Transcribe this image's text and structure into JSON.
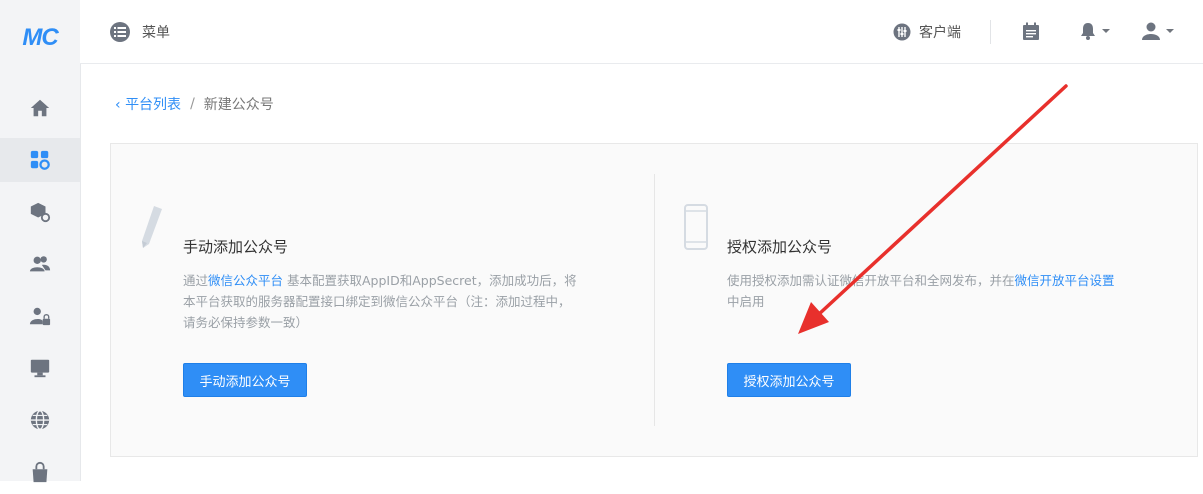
{
  "brand": {
    "logo_text": "MC",
    "accent": "#2f8ef6"
  },
  "sidebar": {
    "items": [
      {
        "icon": "home-icon"
      },
      {
        "icon": "apps-settings-icon",
        "active": true
      },
      {
        "icon": "package-settings-icon"
      },
      {
        "icon": "users-icon"
      },
      {
        "icon": "user-lock-icon"
      },
      {
        "icon": "monitor-icon"
      },
      {
        "icon": "globe-icon"
      },
      {
        "icon": "shopping-bag-icon"
      }
    ]
  },
  "header": {
    "menu_label": "菜单",
    "client_label": "客户端",
    "icons": [
      "calendar-icon",
      "bell-icon",
      "user-icon"
    ]
  },
  "breadcrumb": {
    "back_label": "平台列表",
    "separator": "/",
    "current": "新建公众号"
  },
  "manual": {
    "title": "手动添加公众号",
    "desc_prefix": "通过",
    "desc_link": "微信公众平台",
    "desc_line1_rest": " 基本配置获取AppID和AppSecret，添加成功后，将",
    "desc_line2": "本平台获取的服务器配置接口绑定到微信公众平台（注：添加过程中，",
    "desc_line3": "请务必保持参数一致）",
    "button": "手动添加公众号"
  },
  "auth": {
    "title": "授权添加公众号",
    "desc_prefix": "使用授权添加需认证微信开放平台和全网发布，并在",
    "desc_link": "微信开放平台设置",
    "desc_line2": "中启用",
    "button": "授权添加公众号"
  },
  "annotation": {
    "arrow_color": "#e8302c"
  }
}
